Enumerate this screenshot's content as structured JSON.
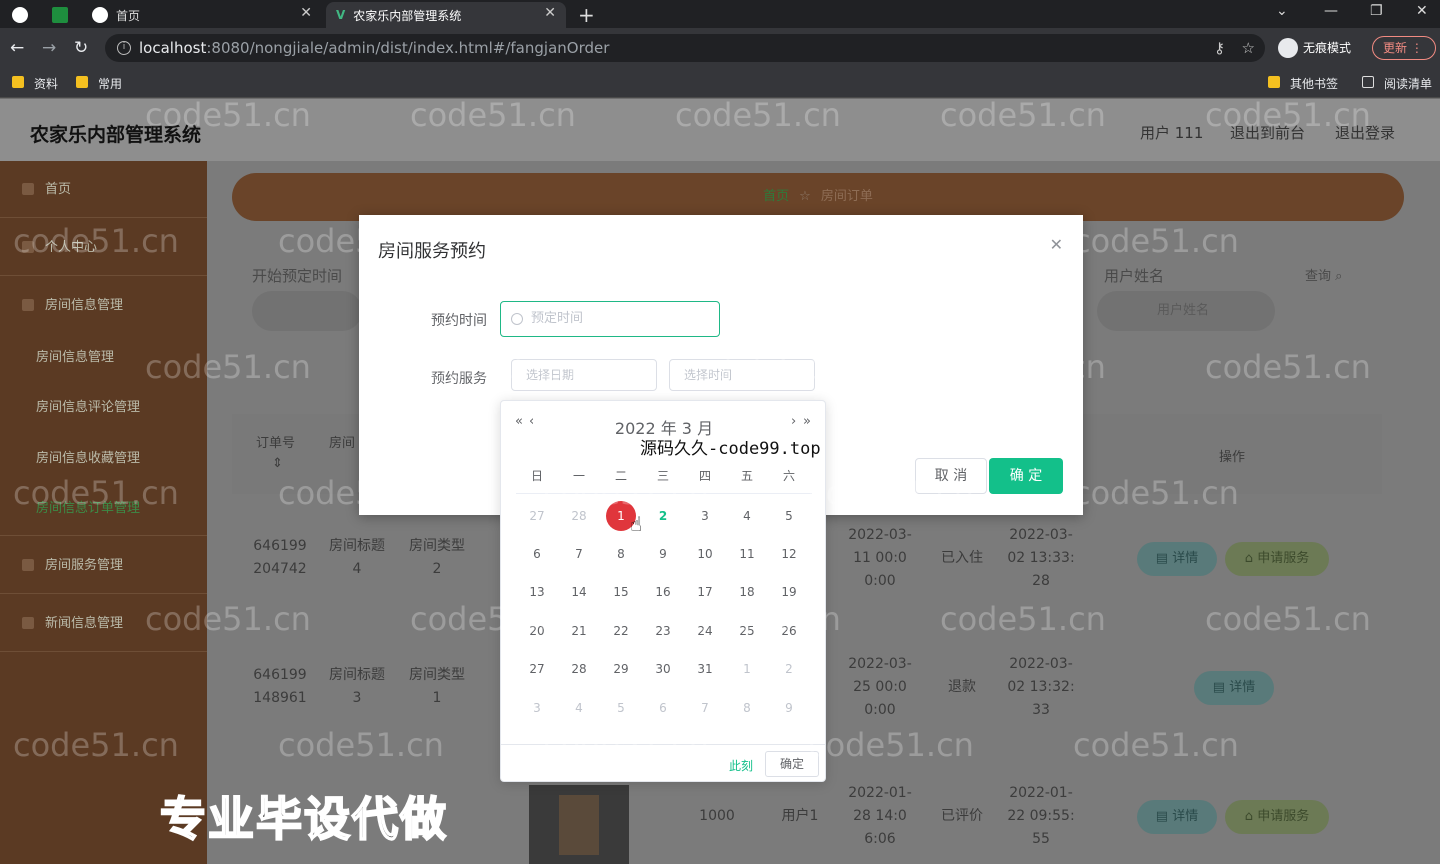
{
  "browser": {
    "tabs": [
      {
        "label": ""
      },
      {
        "label": "首页"
      },
      {
        "label": "农家乐内部管理系统"
      }
    ],
    "url_host": "localhost",
    "url_path": ":8080/nongjiale/admin/dist/index.html#/fangjanOrder",
    "incognito_label": "无痕模式",
    "update_label": "更新",
    "bookmarks": [
      {
        "label": "资料"
      },
      {
        "label": "常用"
      }
    ],
    "bookmarks_right": [
      {
        "label": "其他书签"
      },
      {
        "label": "阅读清单"
      }
    ]
  },
  "app": {
    "title": "农家乐内部管理系统",
    "user": "用户 111",
    "back_front": "退出到前台",
    "logout": "退出登录"
  },
  "sidebar": {
    "items": [
      {
        "label": "首页"
      },
      {
        "label": "个人中心"
      },
      {
        "label": "房间信息管理"
      },
      {
        "label": "房间信息管理"
      },
      {
        "label": "房间信息评论管理"
      },
      {
        "label": "房间信息收藏管理"
      },
      {
        "label": "房间信息订单管理"
      },
      {
        "label": "房间服务管理"
      },
      {
        "label": "新闻信息管理"
      }
    ]
  },
  "main": {
    "crumb_home": "首页",
    "crumb_current": "房间订单",
    "filter_start": "开始预定时间",
    "filter_user": "用户姓名",
    "query": "查询",
    "user_placeholder": "用户姓名",
    "columns": [
      "订单号",
      "房间",
      "操作"
    ],
    "rows": [
      {
        "order": "646199204742",
        "title": "房间标题4",
        "type": "房间类型2",
        "checkin": "2022-03-11 00:00:00",
        "status": "已入住",
        "created": "2022-03-02 13:33:28",
        "detail": "详情",
        "service": "申请服务"
      },
      {
        "order": "646199148961",
        "title": "房间标题3",
        "type": "房间类型1",
        "checkin": "2022-03-25 00:00:00",
        "status": "退款",
        "created": "2022-03-02 13:32:33",
        "detail": "详情"
      },
      {
        "price": "1000",
        "user": "用户1",
        "checkin": "2022-01-28 14:06:06",
        "status": "已评价",
        "created": "2022-01-22 09:55:55",
        "detail": "详情",
        "service": "申请服务"
      }
    ]
  },
  "dialog": {
    "title": "房间服务预约",
    "time_label": "预约时间",
    "time_placeholder": "预定时间",
    "service_label": "预约服务",
    "date_placeholder": "选择日期",
    "time_placeholder2": "选择时间",
    "cancel": "取 消",
    "confirm": "确 定"
  },
  "picker": {
    "title": "2022 年  3 月",
    "weekdays": [
      "日",
      "一",
      "二",
      "三",
      "四",
      "五",
      "六"
    ],
    "weeks": [
      [
        "27",
        "28",
        "1",
        "2",
        "3",
        "4",
        "5"
      ],
      [
        "6",
        "7",
        "8",
        "9",
        "10",
        "11",
        "12"
      ],
      [
        "13",
        "14",
        "15",
        "16",
        "17",
        "18",
        "19"
      ],
      [
        "20",
        "21",
        "22",
        "23",
        "24",
        "25",
        "26"
      ],
      [
        "27",
        "28",
        "29",
        "30",
        "31",
        "1",
        "2"
      ],
      [
        "3",
        "4",
        "5",
        "6",
        "7",
        "8",
        "9"
      ]
    ],
    "now": "此刻",
    "ok": "确定"
  },
  "overlay": {
    "watermark": "code51.cn",
    "promo": "源码久久-code99.top",
    "big_promo": "专业毕设代做"
  }
}
